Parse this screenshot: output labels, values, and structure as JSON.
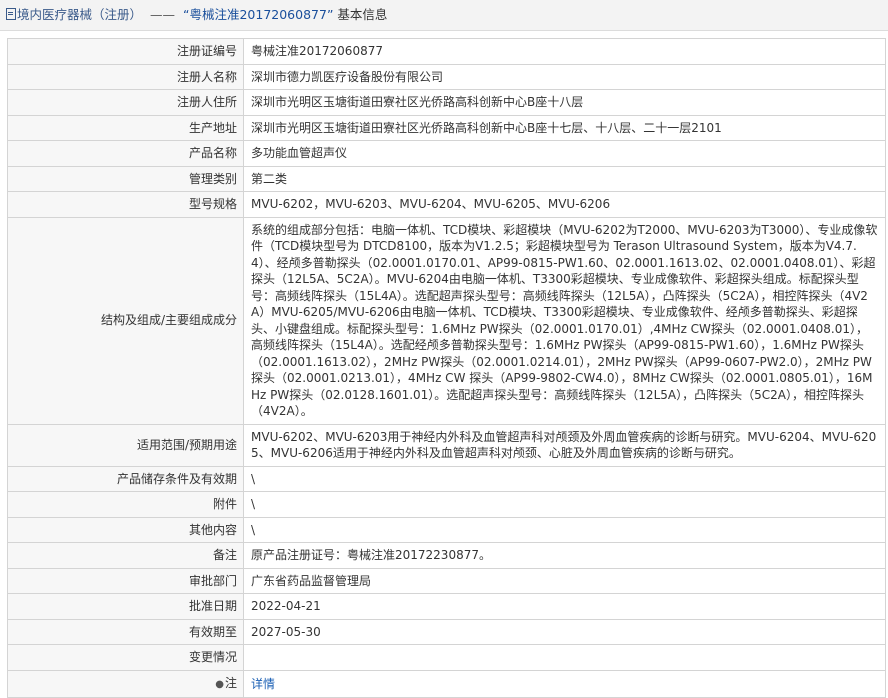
{
  "header": {
    "crumb": "境内医疗器械（注册）",
    "separator": "——",
    "title": "“粤械注准20172060877”",
    "title_suffix": "基本信息",
    "icon": "document-icon"
  },
  "rows": [
    {
      "label": "注册证编号",
      "value": "粤械注准20172060877"
    },
    {
      "label": "注册人名称",
      "value": "深圳市德力凯医疗设备股份有限公司"
    },
    {
      "label": "注册人住所",
      "value": "深圳市光明区玉塘街道田寮社区光侨路高科创新中心B座十八层"
    },
    {
      "label": "生产地址",
      "value": "深圳市光明区玉塘街道田寮社区光侨路高科创新中心B座十七层、十八层、二十一层2101"
    },
    {
      "label": "产品名称",
      "value": "多功能血管超声仪"
    },
    {
      "label": "管理类别",
      "value": "第二类"
    },
    {
      "label": "型号规格",
      "value": "MVU-6202，MVU-6203、MVU-6204、MVU-6205、MVU-6206"
    },
    {
      "label": "结构及组成/主要组成成分",
      "value": "系统的组成部分包括：电脑一体机、TCD模块、彩超模块（MVU-6202为T2000、MVU-6203为T3000）、专业成像软件（TCD模块型号为 DTCD8100，版本为V1.2.5；彩超模块型号为 Terason Ultrasound System，版本为V4.7.4）、经颅多普勒探头（02.0001.0170.01、AP99-0815-PW1.60、02.0001.1613.02、02.0001.0408.01）、彩超探头（12L5A、5C2A）。MVU-6204由电脑一体机、T3300彩超模块、专业成像软件、彩超探头组成。标配探头型号：高频线阵探头（15L4A）。选配超声探头型号：高频线阵探头（12L5A），凸阵探头（5C2A），相控阵探头（4V2A）MVU-6205/MVU-6206由电脑一体机、TCD模块、T3300彩超模块、专业成像软件、经颅多普勒探头、彩超探头、小键盘组成。标配探头型号：1.6MHz PW探头（02.0001.0170.01）,4MHz CW探头（02.0001.0408.01），高频线阵探头（15L4A）。选配经颅多普勒探头型号：1.6MHz PW探头（AP99-0815-PW1.60），1.6MHz PW探头（02.0001.1613.02），2MHz PW探头（02.0001.0214.01），2MHz PW探头（AP99-0607-PW2.0），2MHz PW探头（02.0001.0213.01），4MHz CW 探头（AP99-9802-CW4.0），8MHz CW探头（02.0001.0805.01），16MHz PW探头（02.0128.1601.01）。选配超声探头型号：高频线阵探头（12L5A），凸阵探头（5C2A），相控阵探头（4V2A）。"
    },
    {
      "label": "适用范围/预期用途",
      "value": "MVU-6202、MVU-6203用于神经内外科及血管超声科对颅颈及外周血管疾病的诊断与研究。MVU-6204、MVU-6205、MVU-6206适用于神经内外科及血管超声科对颅颈、心脏及外周血管疾病的诊断与研究。"
    },
    {
      "label": "产品储存条件及有效期",
      "value": "\\"
    },
    {
      "label": "附件",
      "value": "\\"
    },
    {
      "label": "其他内容",
      "value": "\\"
    },
    {
      "label": "备注",
      "value": "原产品注册证号：粤械注准20172230877。"
    },
    {
      "label": "审批部门",
      "value": "广东省药品监督管理局"
    },
    {
      "label": "批准日期",
      "value": "2022-04-21"
    },
    {
      "label": "有效期至",
      "value": "2027-05-30"
    },
    {
      "label": "变更情况",
      "value": ""
    }
  ],
  "note_row": {
    "label": "注",
    "label_icon": "pin-icon",
    "link_text": "详情"
  }
}
